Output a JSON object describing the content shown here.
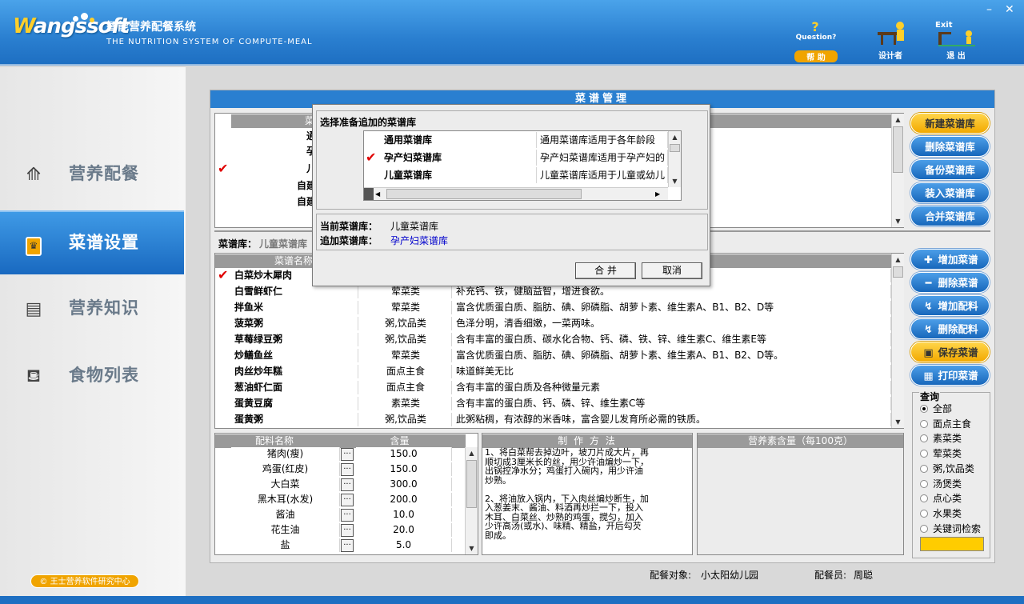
{
  "app": {
    "logo_text": "Wangssoft",
    "title_cn": "智能营养配餐系统",
    "title_en": "THE NUTRITION SYSTEM OF COMPUTE-MEAL",
    "header_buttons": [
      {
        "top": "Question?",
        "label": "帮 助"
      },
      {
        "top": "",
        "label": "设计者"
      },
      {
        "top": "Exit",
        "label": "退 出"
      }
    ],
    "window_min": "–",
    "window_close": "✕"
  },
  "sidebar": {
    "items": [
      {
        "label": "营养配餐",
        "icon": "meal-icon"
      },
      {
        "label": "菜谱设置",
        "icon": "recipe-book-icon",
        "active": true
      },
      {
        "label": "营养知识",
        "icon": "knowledge-icon"
      },
      {
        "label": "食物列表",
        "icon": "food-basket-icon"
      }
    ],
    "copyright": "© 王士营养软件研究中心"
  },
  "main": {
    "title": "菜谱管理",
    "library_header": "菜",
    "library_rows": [
      {
        "name": "通",
        "checked": false
      },
      {
        "name": "孕",
        "checked": false
      },
      {
        "name": "儿",
        "checked": true
      },
      {
        "name": "自建",
        "checked": false
      },
      {
        "name": "自建",
        "checked": false
      }
    ],
    "library_label": "菜谱库：",
    "library_value": "儿童菜谱库",
    "recipe_header": "菜谱名称",
    "recipes": [
      {
        "name": "白菜炒木犀肉",
        "type": "",
        "desc": "",
        "checked": true
      },
      {
        "name": "白雪鲜虾仁",
        "type": "荤菜类",
        "desc": "补充钙、铁，健脑益智，增进食欲。"
      },
      {
        "name": "拌鱼米",
        "type": "荤菜类",
        "desc": "富含优质蛋白质、脂肪、碘、卵磷脂、胡萝卜素、维生素A、B1、B2、D等"
      },
      {
        "name": "菠菜粥",
        "type": "粥,饮品类",
        "desc": "色泽分明，清香细嫩，一菜两味。"
      },
      {
        "name": "草莓绿豆粥",
        "type": "粥,饮品类",
        "desc": "含有丰富的蛋白质、碳水化合物、钙、磷、铁、锌、维生素C、维生素E等"
      },
      {
        "name": "炒鳝鱼丝",
        "type": "荤菜类",
        "desc": "富含优质蛋白质、脂肪、碘、卵磷脂、胡萝卜素、维生素A、B1、B2、D等。"
      },
      {
        "name": "肉丝炒年糕",
        "type": "面点主食",
        "desc": "味道鲜美无比"
      },
      {
        "name": "葱油虾仁面",
        "type": "面点主食",
        "desc": "含有丰富的蛋白质及各种微量元素"
      },
      {
        "name": "蛋黄豆腐",
        "type": "素菜类",
        "desc": "含有丰富的蛋白质、钙、磷、锌、维生素C等"
      },
      {
        "name": "蛋黄粥",
        "type": "粥,饮品类",
        "desc": "此粥粘稠，有浓醇的米香味，富含婴儿发育所必需的铁质。"
      }
    ],
    "ingredient_headers": [
      "配料名称",
      "含量"
    ],
    "ingredients": [
      {
        "name": "猪肉(瘦)",
        "amount": "150.0"
      },
      {
        "name": "鸡蛋(红皮)",
        "amount": "150.0"
      },
      {
        "name": "大白菜",
        "amount": "300.0"
      },
      {
        "name": "黑木耳(水发)",
        "amount": "200.0"
      },
      {
        "name": "酱油",
        "amount": "10.0"
      },
      {
        "name": "花生油",
        "amount": "20.0"
      },
      {
        "name": "盐",
        "amount": "5.0"
      }
    ],
    "dots": "...",
    "method_header": "制 作 方 法",
    "method_lines": [
      "1、将白菜帮去掉边叶，坡刀片成大片，再",
      "顺切成3厘米长的丝，用少许油煸炒一下，",
      "出锅控净水分；鸡蛋打入碗内，用少许油",
      "炒熟。",
      "",
      "2、将油放入锅内，下入肉丝煸炒断生，加",
      "入葱姜末、酱油、料酒再炒拦一下，投入",
      "木耳、白菜丝、炒熟的鸡蛋，搅匀，加入",
      "少许高汤(或水)、味精、精盐，开后勾芡",
      "即成。"
    ],
    "nutrition_header": "营养素含量（每100克）",
    "buttons_top": [
      {
        "label": "新建菜谱库",
        "style": "yellow"
      },
      {
        "label": "删除菜谱库",
        "style": "blue"
      },
      {
        "label": "备份菜谱库",
        "style": "blue"
      },
      {
        "label": "装入菜谱库",
        "style": "blue"
      },
      {
        "label": "合并菜谱库",
        "style": "blue"
      }
    ],
    "buttons_bottom": [
      {
        "label": "增加菜谱",
        "style": "blue",
        "icon": "plus-icon",
        "glyph": "✚"
      },
      {
        "label": "删除菜谱",
        "style": "blue",
        "icon": "minus-icon",
        "glyph": "━"
      },
      {
        "label": "增加配料",
        "style": "blue",
        "icon": "add-ingredient-icon",
        "glyph": "↯"
      },
      {
        "label": "删除配料",
        "style": "blue",
        "icon": "remove-ingredient-icon",
        "glyph": "↯"
      },
      {
        "label": "保存菜谱",
        "style": "yellow",
        "icon": "save-icon",
        "glyph": "▣"
      },
      {
        "label": "打印菜谱",
        "style": "blue",
        "icon": "print-icon",
        "glyph": "▦"
      }
    ],
    "query": {
      "title": "查询",
      "options": [
        "全部",
        "面点主食",
        "素菜类",
        "荤菜类",
        "粥,饮品类",
        "汤煲类",
        "点心类",
        "水果类",
        "关键词检索"
      ],
      "selected": "全部"
    },
    "footer_target_label": "配餐对象:",
    "footer_target": "小太阳幼儿园",
    "footer_staff_label": "配餐员:",
    "footer_staff": "周聪"
  },
  "dialog": {
    "title": "选择准备追加的菜谱库",
    "rows": [
      {
        "name": "通用菜谱库",
        "desc": "通用菜谱库适用于各年龄段",
        "checked": false
      },
      {
        "name": "孕产妇菜谱库",
        "desc": "孕产妇菜谱库适用于孕产妇的",
        "checked": true
      },
      {
        "name": "儿童菜谱库",
        "desc": "儿童菜谱库适用于儿童或幼儿",
        "checked": false
      }
    ],
    "current_label": "当前菜谱库：",
    "current_value": "儿童菜谱库",
    "append_label": "追加菜谱库：",
    "append_value": "孕产妇菜谱库",
    "merge_button": "合 并",
    "cancel_button": "取消"
  }
}
